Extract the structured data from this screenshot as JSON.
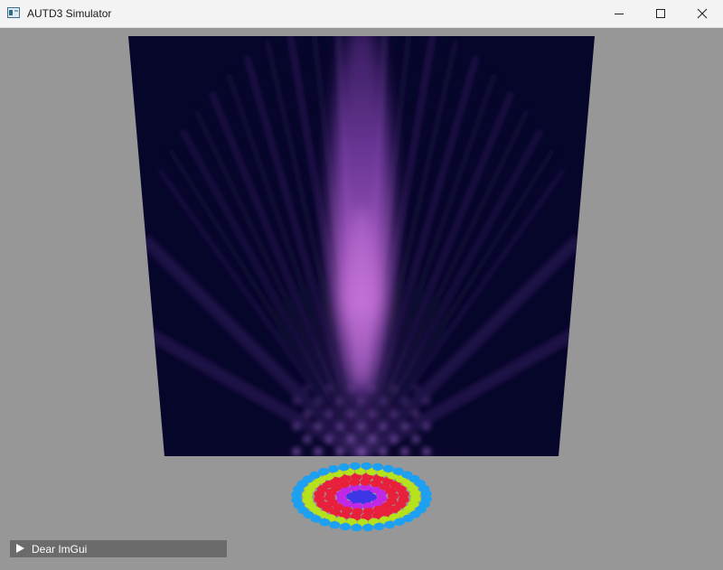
{
  "window": {
    "title": "AUTD3 Simulator",
    "controls": {
      "minimize": "minimize-icon",
      "maximize": "maximize-icon",
      "close": "close-icon"
    }
  },
  "viewport": {
    "background_color": "#979797",
    "field_slice": {
      "colormap": [
        "#05052a",
        "#2a1650",
        "#6a3a9a",
        "#9a56c8",
        "#c87ad8"
      ],
      "description": "acoustic pressure field slice"
    },
    "transducer_array": {
      "ring_colors": [
        "#3c36e6",
        "#c028e6",
        "#e8203c",
        "#b6e21c",
        "#1ea0f0"
      ]
    }
  },
  "imgui": {
    "window_label": "Dear ImGui",
    "collapsed": true
  }
}
